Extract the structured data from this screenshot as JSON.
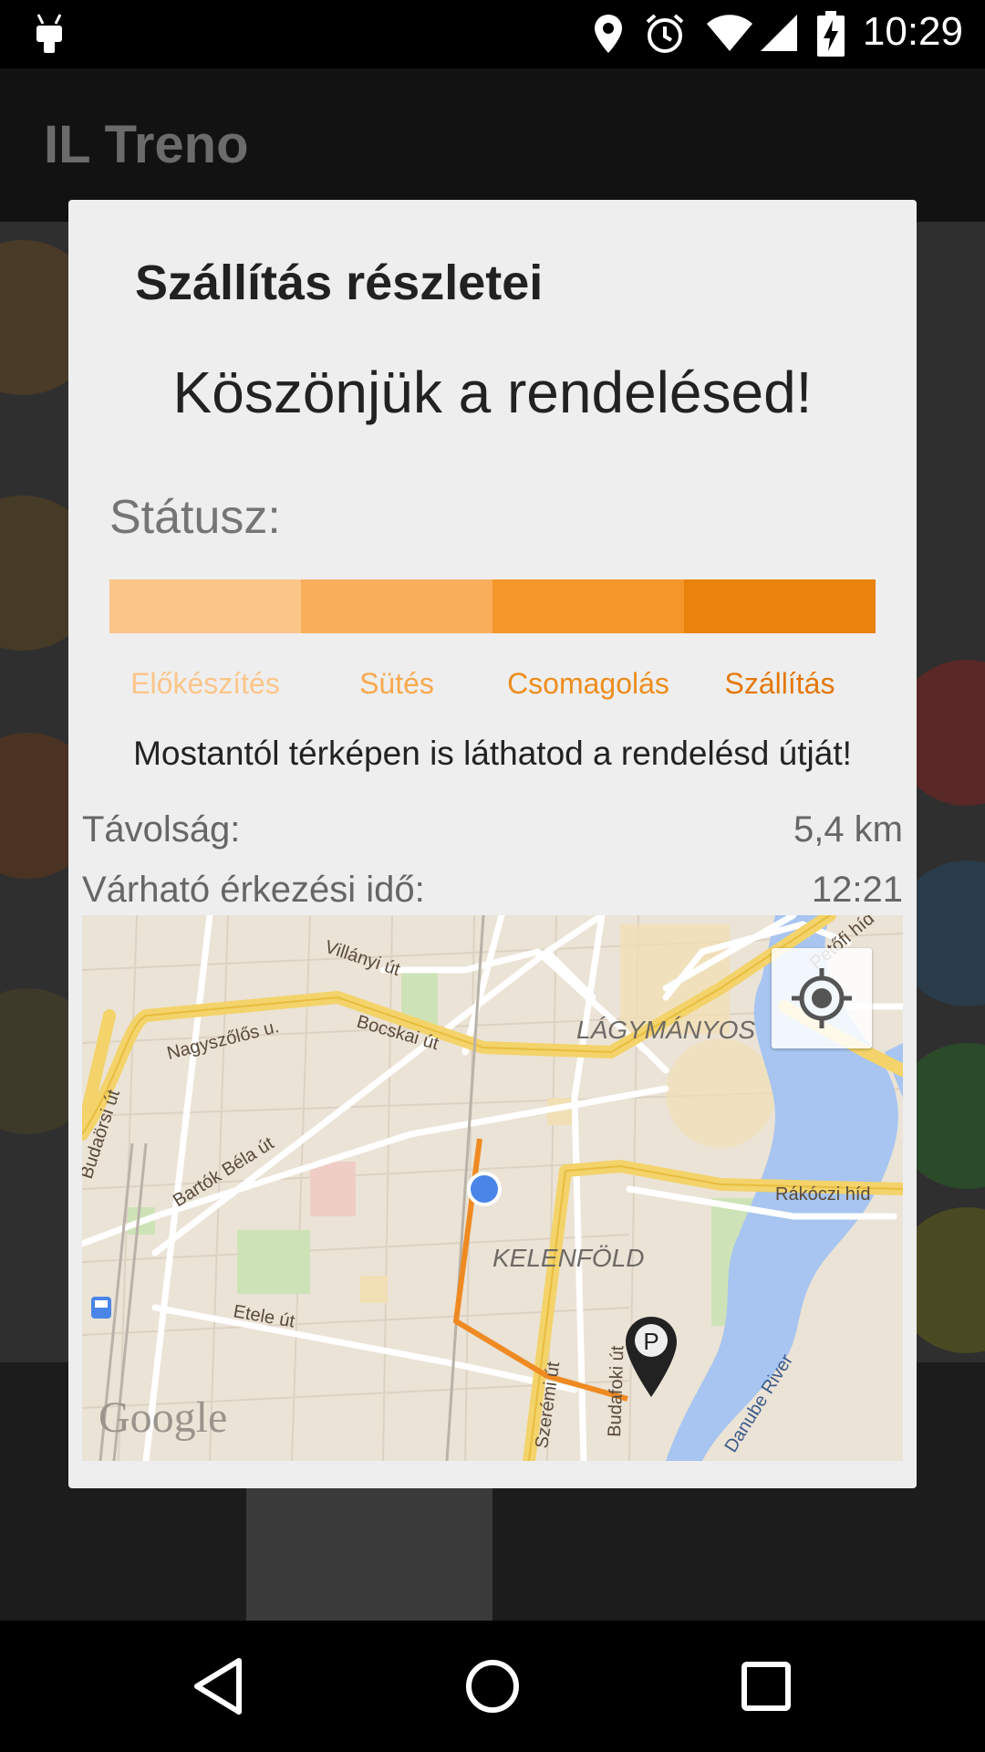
{
  "status_bar": {
    "time": "10:29",
    "icons": [
      "android-icon",
      "location-icon",
      "alarm-icon",
      "wifi-icon",
      "signal-icon",
      "battery-charging-icon"
    ]
  },
  "app_bar": {
    "title": "IL Treno"
  },
  "dialog": {
    "title": "Szállítás részletei",
    "thanks": "Köszönjük a rendelésed!",
    "status_label": "Státusz:",
    "stages": [
      {
        "label": "Előkészítés",
        "color": "#fcc58a",
        "text_color": "#fcc58a"
      },
      {
        "label": "Sütés",
        "color": "#f9ae5b",
        "text_color": "#f8a94e"
      },
      {
        "label": "Csomagolás",
        "color": "#f4962a",
        "text_color": "#ee8d1d"
      },
      {
        "label": "Szállítás",
        "color": "#ea820e",
        "text_color": "#e4780b"
      }
    ],
    "note": "Mostantól térképen is láthatod a rendelésd útját!",
    "distance": {
      "label": "Távolság:",
      "value": "5,4 km"
    },
    "eta": {
      "label": "Várható érkezési idő:",
      "value": "12:21"
    }
  },
  "map": {
    "labels": {
      "villanyi": "Villányi út",
      "nagyszolos": "Nagyszőlős u.",
      "bocskai": "Bocskai út",
      "lagymanyos": "LÁGYMÁNYOS",
      "petofi": "Petőfi híd",
      "budaorsi": "Budaörsi út",
      "bartok": "Bartók Béla út",
      "rakoczi": "Rákóczi híd",
      "kelenfold": "KELENFÖLD",
      "etele": "Etele út",
      "szeremi": "Szerémi út",
      "budafoki": "Budafoki út",
      "danube": "Danube River",
      "google": "Google",
      "parking": "P"
    }
  },
  "colors": {
    "accent": "#ea820e",
    "dialog_bg": "#eeeeee"
  }
}
